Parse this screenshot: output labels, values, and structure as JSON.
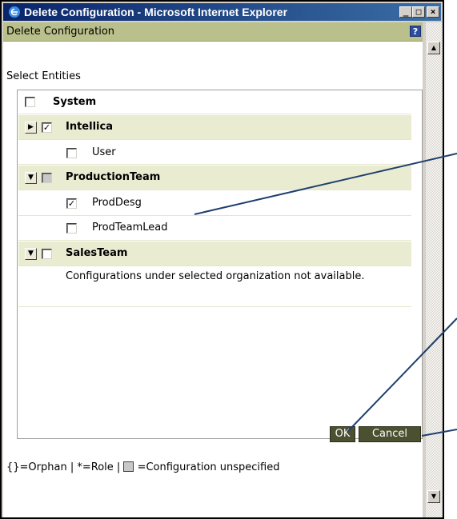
{
  "window": {
    "title": "Delete Configuration - Microsoft Internet Explorer",
    "minimize_glyph": "_",
    "maximize_glyph": "□",
    "close_glyph": "×"
  },
  "header": {
    "title": "Delete Configuration",
    "help_glyph": "?"
  },
  "select_label": "Select Entities",
  "tree": {
    "root": {
      "label": "System",
      "checked": false
    },
    "orgs": [
      {
        "label": "Intellica",
        "expander": "▶",
        "checked": true,
        "grey": false,
        "children": [
          {
            "label": "User",
            "checked": false
          }
        ]
      },
      {
        "label": "ProductionTeam",
        "expander": "▼",
        "checked": false,
        "grey": true,
        "children": [
          {
            "label": "ProdDesg",
            "checked": true
          },
          {
            "label": "ProdTeamLead",
            "checked": false
          }
        ]
      },
      {
        "label": "SalesTeam",
        "expander": "▼",
        "checked": false,
        "grey": false,
        "note": "Configurations under selected organization not available."
      }
    ]
  },
  "check_glyph": "✓",
  "buttons": {
    "ok": "OK",
    "cancel": "Cancel"
  },
  "legend": {
    "prefix": "{}=Orphan | *=Role |",
    "suffix": "=Configuration unspecified"
  },
  "scrollbar": {
    "up": "▲",
    "down": "▼"
  },
  "colors": {
    "header_bg": "#b9c08b",
    "org_row_bg": "#e9ecd1",
    "button_bg": "#4a5030",
    "callout": "#1f3f6e"
  }
}
